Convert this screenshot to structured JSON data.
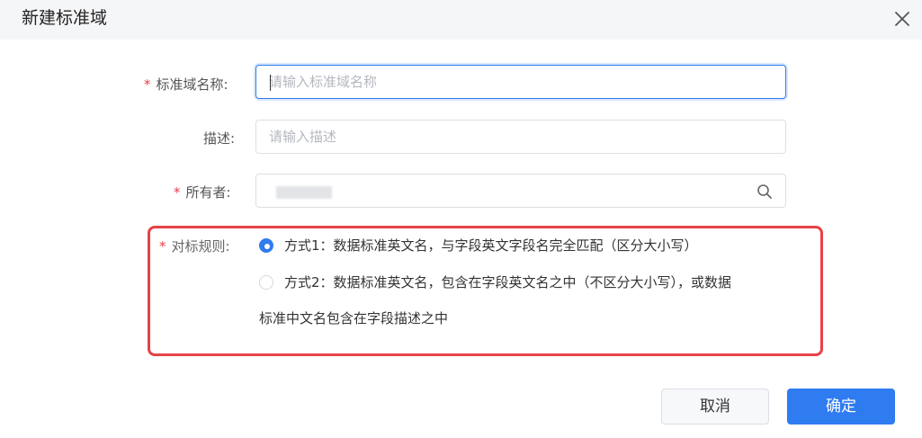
{
  "dialog": {
    "title": "新建标准域"
  },
  "form": {
    "name": {
      "label": "标准域名称:",
      "placeholder": "请输入标准域名称",
      "value": ""
    },
    "description": {
      "label": "描述:",
      "placeholder": "请输入描述",
      "value": ""
    },
    "owner": {
      "label": "所有者:"
    },
    "rule": {
      "label": "对标规则:",
      "options": [
        {
          "label": "方式1：数据标准英文名，与字段英文字段名完全匹配（区分大小写）",
          "checked": true
        },
        {
          "label": "方式2：数据标准英文名，包含在字段英文名之中（不区分大小写），或数据",
          "checked": false
        }
      ],
      "option2_continuation": "标准中文名包含在字段描述之中"
    },
    "required_mark": "*"
  },
  "footer": {
    "cancel_label": "取消",
    "ok_label": "确定"
  },
  "colors": {
    "accent": "#2f7bf0",
    "highlight_box": "#e84148",
    "required": "#e8404a"
  },
  "icons": [
    "close-icon",
    "search-icon"
  ]
}
